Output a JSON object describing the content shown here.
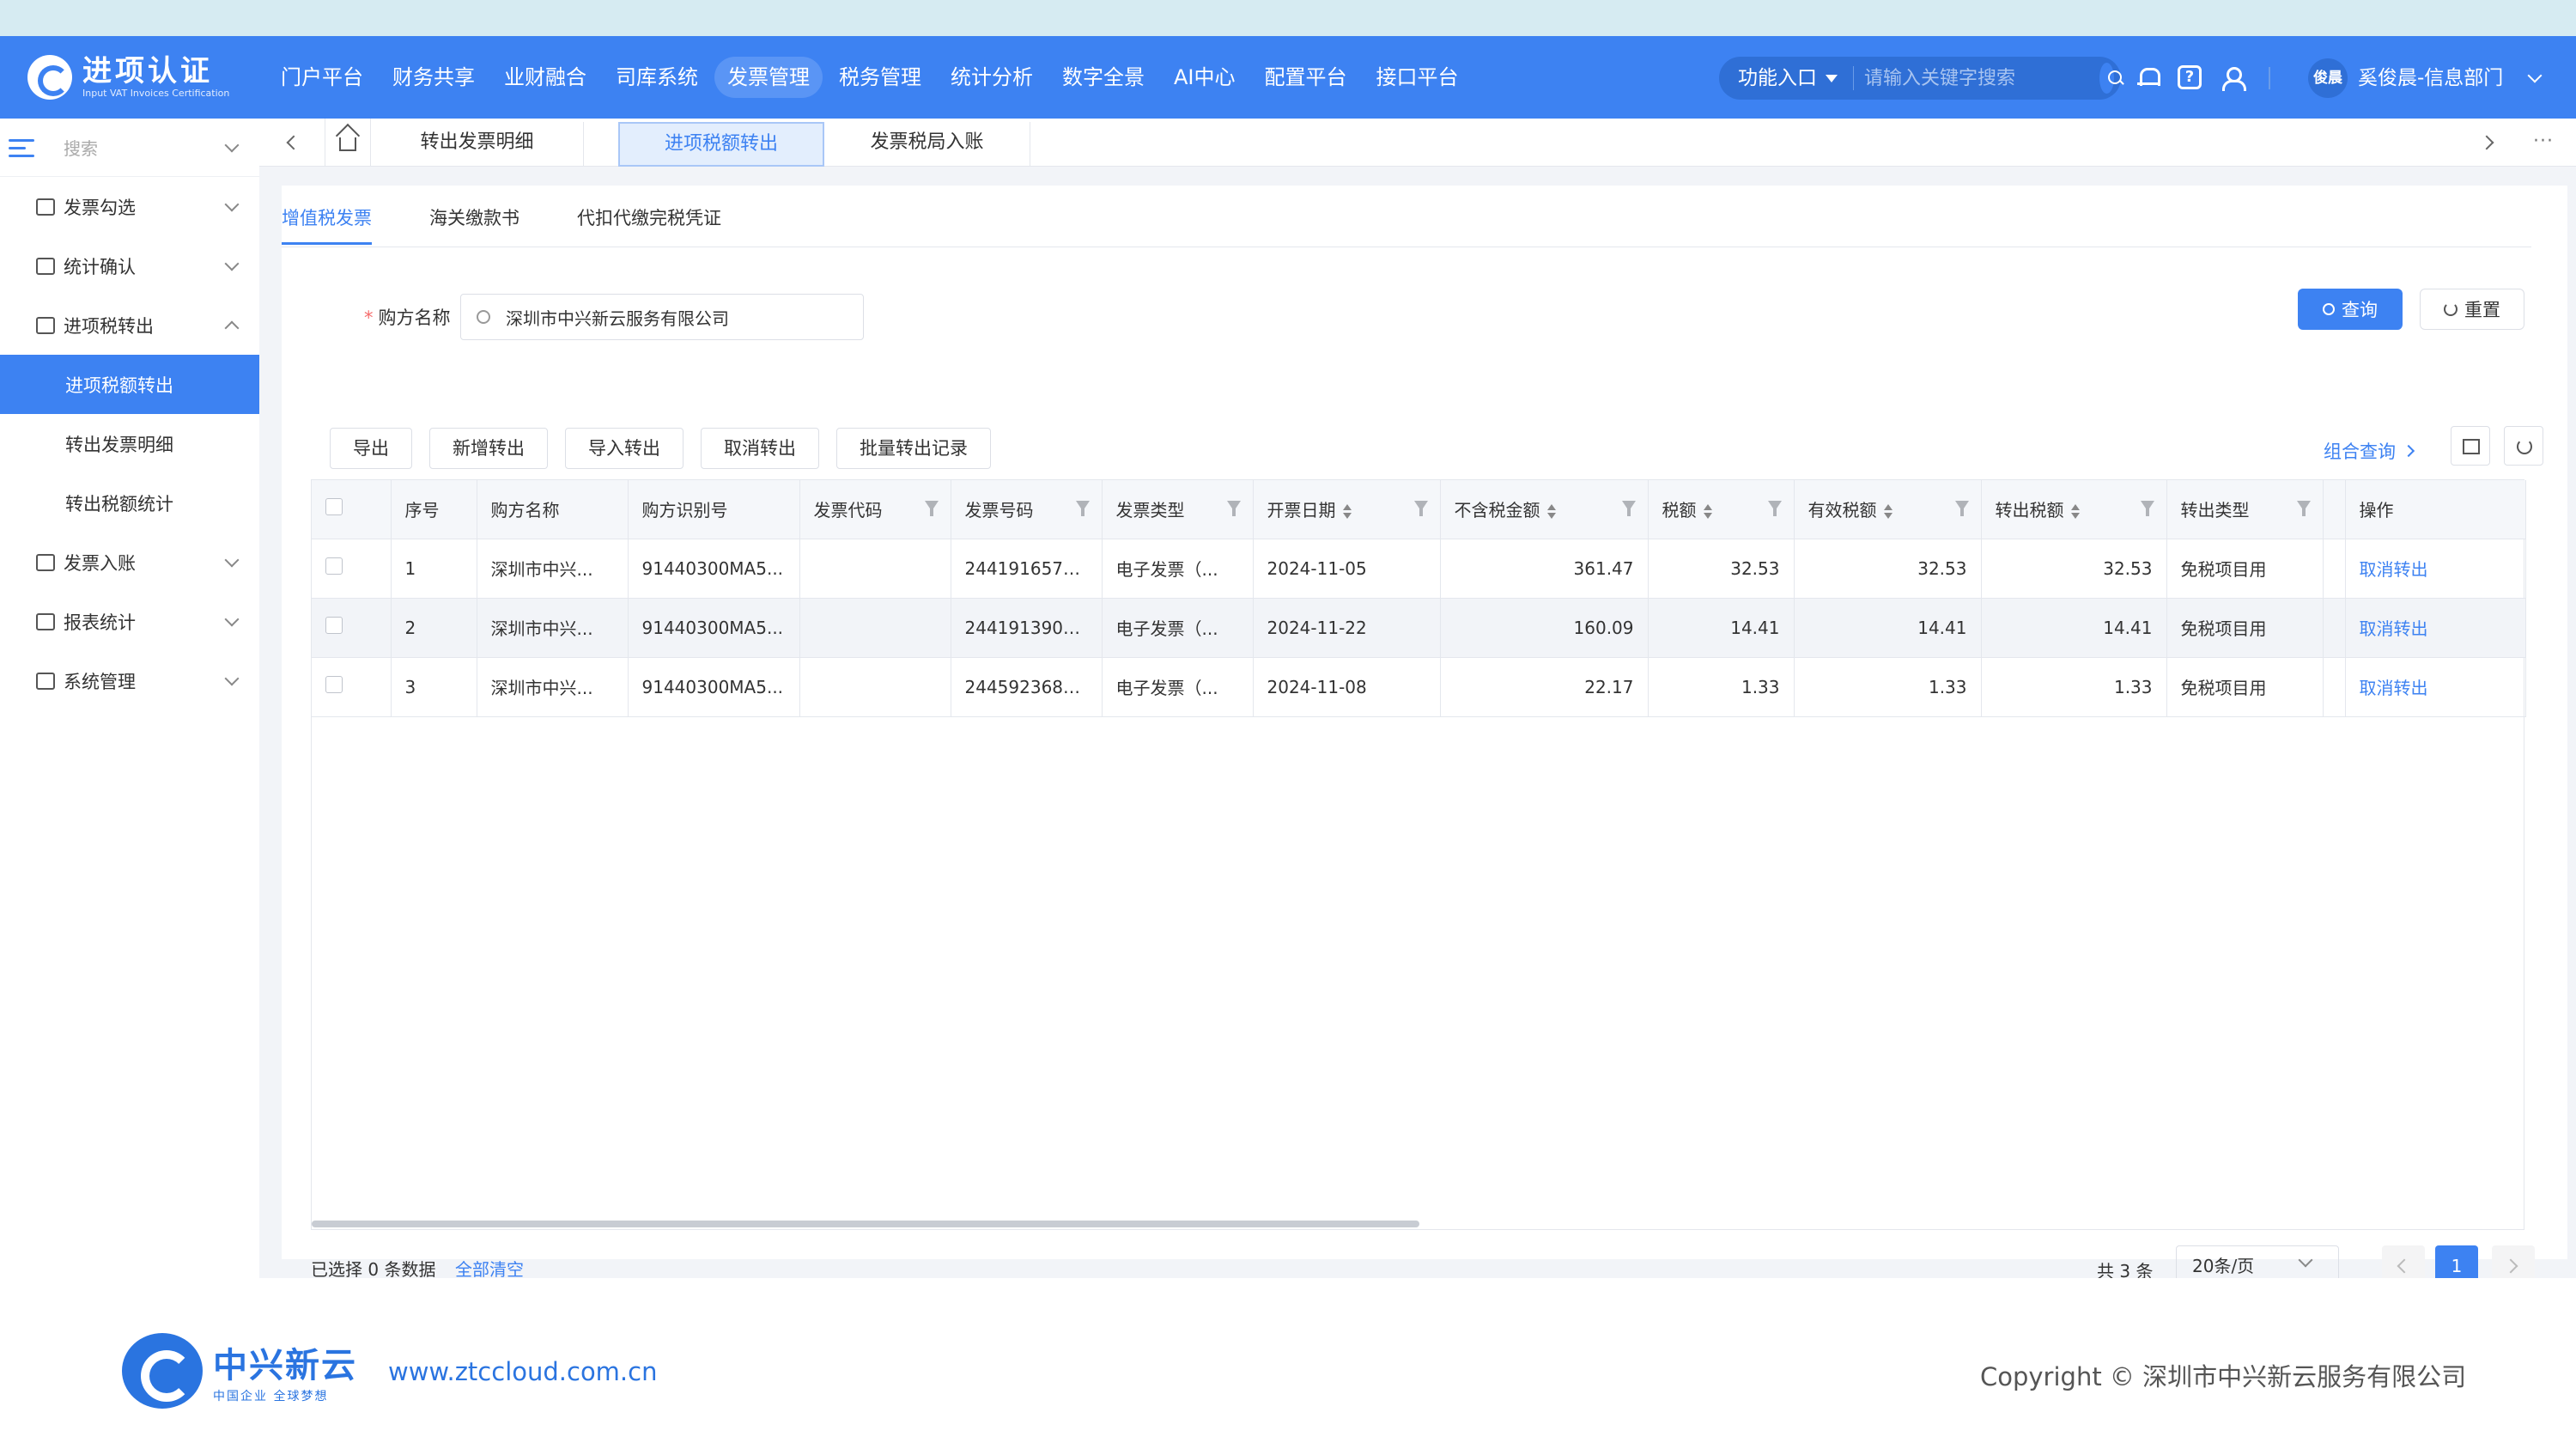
{
  "header": {
    "logo_title": "进项认证",
    "logo_subtitle": "Input VAT Invoices Certification",
    "nav": [
      "门户平台",
      "财务共享",
      "业财融合",
      "司库系统",
      "发票管理",
      "税务管理",
      "统计分析",
      "数字全景",
      "AI中心",
      "配置平台",
      "接口平台"
    ],
    "active_nav": "发票管理",
    "func_entry": "功能入口",
    "search_placeholder": "请输入关键字搜索",
    "help_glyph": "?",
    "avatar_text": "俊晨",
    "user_name": "奚俊晨-信息部门"
  },
  "sidebar": {
    "search_placeholder": "搜索",
    "items": [
      {
        "label": "发票勾选",
        "expanded": false
      },
      {
        "label": "统计确认",
        "expanded": false
      },
      {
        "label": "进项税转出",
        "expanded": true
      },
      {
        "label": "发票入账",
        "expanded": false
      },
      {
        "label": "报表统计",
        "expanded": false
      },
      {
        "label": "系统管理",
        "expanded": false
      }
    ],
    "sub_items": [
      "进项税额转出",
      "转出发票明细",
      "转出税额统计"
    ],
    "active_sub": "进项税额转出"
  },
  "tabs": [
    "转出发票明细",
    "进项税额转出",
    "发票税局入账"
  ],
  "active_tab": "进项税额转出",
  "subtabs": [
    "增值税发票",
    "海关缴款书",
    "代扣代缴完税凭证"
  ],
  "form": {
    "required_mark": "*",
    "label": "购方名称",
    "value": "深圳市中兴新云服务有限公司",
    "query_button": "查询",
    "reset_button": "重置"
  },
  "toolbar": {
    "buttons": [
      "导出",
      "新增转出",
      "导入转出",
      "取消转出",
      "批量转出记录"
    ],
    "combo_query": "组合查询"
  },
  "table": {
    "columns": [
      "序号",
      "购方名称",
      "购方识别号",
      "发票代码",
      "发票号码",
      "发票类型",
      "开票日期",
      "不含税金额",
      "税额",
      "有效税额",
      "转出税额",
      "转出类型",
      "",
      "操作"
    ],
    "rows": [
      [
        "1",
        "深圳市中兴...",
        "91440300MA5...",
        "",
        "2441916577...",
        "电子发票（...",
        "2024-11-05",
        "361.47",
        "32.53",
        "32.53",
        "32.53",
        "免税项目用",
        "",
        "取消转出"
      ],
      [
        "2",
        "深圳市中兴...",
        "91440300MA5...",
        "",
        "2441913905...",
        "电子发票（...",
        "2024-11-22",
        "160.09",
        "14.41",
        "14.41",
        "14.41",
        "免税项目用",
        "",
        "取消转出"
      ],
      [
        "3",
        "深圳市中兴...",
        "91440300MA5...",
        "",
        "2445923688...",
        "电子发票（...",
        "2024-11-08",
        "22.17",
        "1.33",
        "1.33",
        "1.33",
        "免税项目用",
        "",
        "取消转出"
      ]
    ]
  },
  "pagination": {
    "selected_info": "已选择 0 条数据",
    "clear_all": "全部清空",
    "total": "共 3 条",
    "page_size": "20条/页",
    "current_page": "1"
  },
  "page_footer": {
    "brand": "中兴新云",
    "slogan": "中国企业 全球梦想",
    "url": "www.ztccloud.com.cn",
    "copyright": "Copyright © 深圳市中兴新云服务有限公司"
  },
  "colors": {
    "primary": "#3d82f2",
    "header_bg": "#3d82f2",
    "danger": "#f56c6c"
  }
}
